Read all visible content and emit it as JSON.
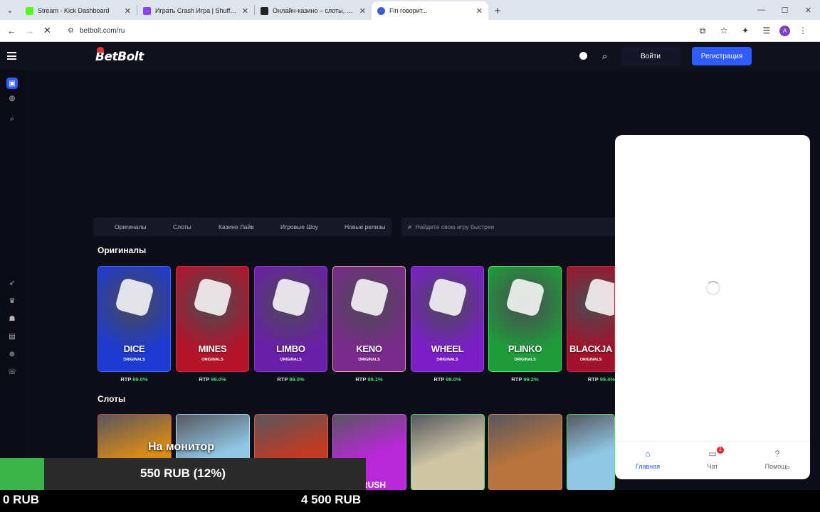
{
  "browser": {
    "tabs": [
      {
        "title": "Stream - Kick Dashboard",
        "color": "#53fc18"
      },
      {
        "title": "Играть Crash Игра | Shuffle - V",
        "color": "#8a44ff"
      },
      {
        "title": "Онлайн-казино – слоты, лайв",
        "color": "#222222"
      },
      {
        "title": "Fin говорит...",
        "color": "#3b5bdb"
      }
    ],
    "url": "betbolt.com/ru",
    "avatar_letter": "A"
  },
  "header": {
    "logo": "BetBolt",
    "login_label": "Войти",
    "register_label": "Регистрация"
  },
  "categories": [
    "Оригиналы",
    "Слоты",
    "Казино Лайв",
    "Игровые Шоу",
    "Новые релизы"
  ],
  "search": {
    "placeholder": "Найдите свою игру быстрее"
  },
  "originals": {
    "title": "Оригиналы",
    "games": [
      {
        "name": "DICE",
        "sub": "ORIGINALS",
        "rtp_label": "RTP",
        "rtp": "99.0%",
        "bg": "#1d3ad1",
        "border": "#3a6cff"
      },
      {
        "name": "MINES",
        "sub": "ORIGINALS",
        "rtp_label": "RTP",
        "rtp": "99.0%",
        "bg": "#b4142a",
        "border": "#d42a3f"
      },
      {
        "name": "LIMBO",
        "sub": "ORIGINALS",
        "rtp_label": "RTP",
        "rtp": "99.0%",
        "bg": "#6b1fa8",
        "border": "#8d3ad0"
      },
      {
        "name": "KENO",
        "sub": "ORIGINALS",
        "rtp_label": "RTP",
        "rtp": "99.1%",
        "bg": "#7a2a8c",
        "border": "#e89aa6"
      },
      {
        "name": "WHEEL",
        "sub": "ORIGINALS",
        "rtp_label": "RTP",
        "rtp": "99.0%",
        "bg": "#7b1ec8",
        "border": "#9a3ce0"
      },
      {
        "name": "PLINKO",
        "sub": "ORIGINALS",
        "rtp_label": "RTP",
        "rtp": "99.2%",
        "bg": "#1e9c3a",
        "border": "#4ce86b"
      },
      {
        "name": "BLACKJA",
        "sub": "ORIGINALS",
        "rtp_label": "RTP",
        "rtp": "99.4%",
        "bg": "#a3122b",
        "border": "#c52a3f"
      }
    ]
  },
  "slots": {
    "title": "Слоты",
    "games": [
      {
        "bg": "#d98a17",
        "border": "#e04a3a"
      },
      {
        "bg": "#8fc7e4",
        "border": "#b8dff2"
      },
      {
        "bg": "#c23a22",
        "border": "#e35a3a"
      },
      {
        "bg": "#b928d8",
        "border": "#d060ee",
        "label": "R RUSH"
      },
      {
        "bg": "#cfc6a6",
        "border": "#4ce86b"
      },
      {
        "bg": "#b8743a",
        "border": "#d4955c"
      },
      {
        "bg": "#8fc7e4",
        "border": "#4ce86b"
      }
    ]
  },
  "popup": {
    "nav": [
      {
        "label": "Главная",
        "icon": "home-icon"
      },
      {
        "label": "Чат",
        "icon": "chat-icon",
        "badge": "1"
      },
      {
        "label": "Помощь",
        "icon": "help-icon"
      }
    ]
  },
  "stream_overlay": {
    "caption": "На монитор",
    "progress_label": "550 RUB (12%)",
    "progress_percent": 12,
    "min_label": "0 RUB",
    "max_label": "4 500 RUB"
  }
}
